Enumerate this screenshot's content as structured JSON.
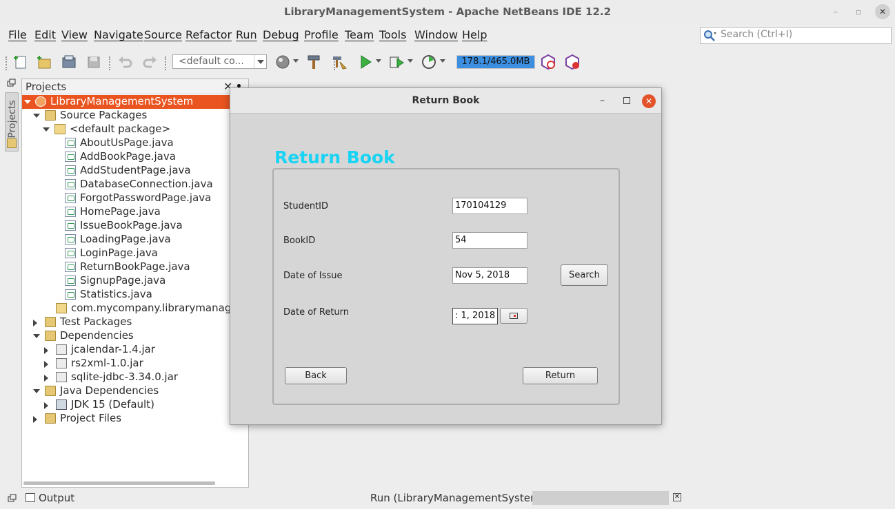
{
  "window": {
    "title": "LibraryManagementSystem - Apache NetBeans IDE 12.2",
    "minimize": "–",
    "maximize": "▫",
    "close": "✕"
  },
  "menu": [
    "File",
    "Edit",
    "View",
    "Navigate",
    "Source",
    "Refactor",
    "Run",
    "Debug",
    "Profile",
    "Team",
    "Tools",
    "Window",
    "Help"
  ],
  "search": {
    "placeholder": "Search (Ctrl+I)"
  },
  "toolbar": {
    "config_select": "<default co...",
    "memory": "178.1/465.0MB",
    "memory_used_mb": 178.1,
    "memory_total_mb": 465.0
  },
  "side": {
    "projects_tab": "Projects"
  },
  "projects": {
    "title": "Projects",
    "close": "✕",
    "tree": [
      {
        "label": "LibraryManagementSystem",
        "icon": "project-icon",
        "depth": 0,
        "expander": "open",
        "selected": true
      },
      {
        "label": "Source Packages",
        "icon": "folder",
        "depth": 1,
        "expander": "open"
      },
      {
        "label": "<default package>",
        "icon": "pkg",
        "depth": 2,
        "expander": "open"
      },
      {
        "label": "AboutUsPage.java",
        "icon": "file",
        "depth": 3
      },
      {
        "label": "AddBookPage.java",
        "icon": "file",
        "depth": 3
      },
      {
        "label": "AddStudentPage.java",
        "icon": "file",
        "depth": 3
      },
      {
        "label": "DatabaseConnection.java",
        "icon": "file",
        "depth": 3
      },
      {
        "label": "ForgotPasswordPage.java",
        "icon": "file",
        "depth": 3
      },
      {
        "label": "HomePage.java",
        "icon": "file",
        "depth": 3
      },
      {
        "label": "IssueBookPage.java",
        "icon": "file",
        "depth": 3
      },
      {
        "label": "LoadingPage.java",
        "icon": "file",
        "depth": 3
      },
      {
        "label": "LoginPage.java",
        "icon": "file",
        "depth": 3
      },
      {
        "label": "ReturnBookPage.java",
        "icon": "file",
        "depth": 3
      },
      {
        "label": "SignupPage.java",
        "icon": "file",
        "depth": 3
      },
      {
        "label": "Statistics.java",
        "icon": "file",
        "depth": 3
      },
      {
        "label": "com.mycompany.librarymanagem",
        "icon": "pkg",
        "depth": 2
      },
      {
        "label": "Test Packages",
        "icon": "folder",
        "depth": 1,
        "expander": "closed"
      },
      {
        "label": "Dependencies",
        "icon": "folder",
        "depth": 1,
        "expander": "open"
      },
      {
        "label": "jcalendar-1.4.jar",
        "icon": "jar",
        "depth": 2,
        "expander": "closed"
      },
      {
        "label": "rs2xml-1.0.jar",
        "icon": "jar",
        "depth": 2,
        "expander": "closed"
      },
      {
        "label": "sqlite-jdbc-3.34.0.jar",
        "icon": "jar",
        "depth": 2,
        "expander": "closed"
      },
      {
        "label": "Java Dependencies",
        "icon": "folder",
        "depth": 1,
        "expander": "open"
      },
      {
        "label": "JDK 15 (Default)",
        "icon": "jdk",
        "depth": 2,
        "expander": "closed"
      },
      {
        "label": "Project Files",
        "icon": "folder",
        "depth": 1,
        "expander": "closed"
      }
    ]
  },
  "bottom": {
    "output": "Output",
    "run_status": "Run (LibraryManagementSystem)",
    "close": "✕"
  },
  "dialog": {
    "title": "Return Book",
    "minimize": "–",
    "close": "✕",
    "heading": "Return Book",
    "student_id_label": "StudentID",
    "student_id_value": "170104129",
    "book_id_label": "BookID",
    "book_id_value": "54",
    "issue_date_label": "Date of Issue",
    "issue_date_value": "Nov 5, 2018",
    "search_button": "Search",
    "return_date_label": "Date of Return",
    "return_date_value": ": 1, 2018",
    "back_button": "Back",
    "return_button": "Return"
  },
  "colors": {
    "selection": "#e95420",
    "heading": "#18d4f4",
    "memory_fill": "#3c8fe0",
    "dialog_close": "#e2532a"
  }
}
